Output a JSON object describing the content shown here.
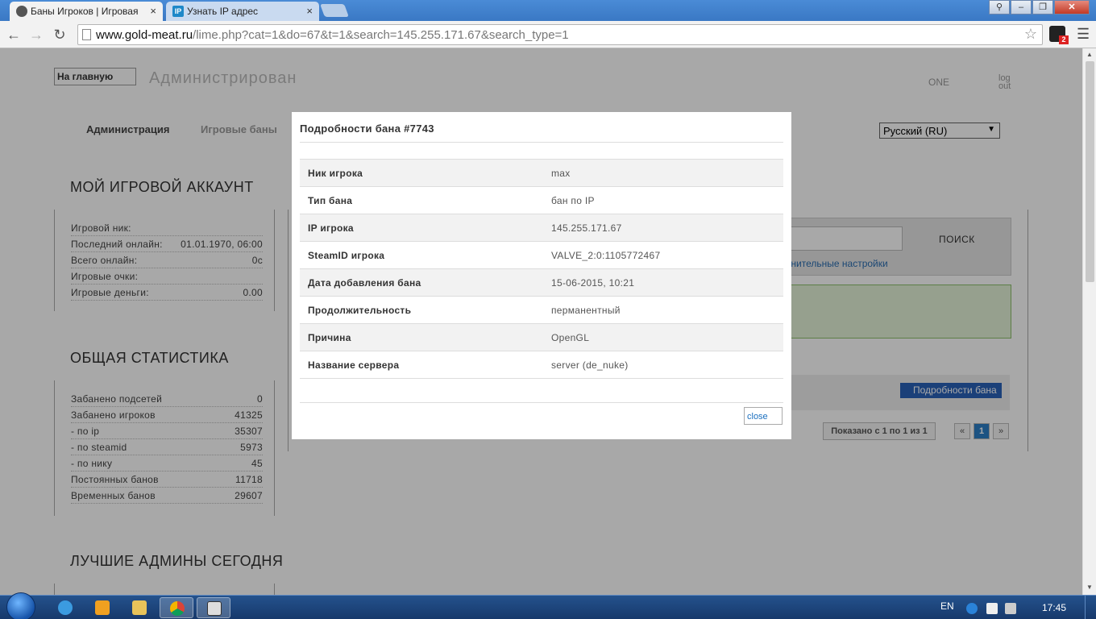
{
  "browser": {
    "tabs": [
      {
        "title": "Баны Игроков | Игровая"
      },
      {
        "title": "Узнать IP адрес",
        "favicon_text": "IP"
      }
    ],
    "tab_close_glyph": "×",
    "url_host": "www.gold-meat.ru",
    "url_path": "/lime.php?cat=1&do=67&t=1&search=145.255.171.67&search_type=1",
    "extension_badge": "2"
  },
  "page": {
    "logo_alt": "На главную",
    "logo_text": "Администрирован",
    "top_links": {
      "one": "ONE",
      "logout": "log out"
    },
    "menu": [
      "Администрация",
      "Игровые баны"
    ],
    "language": "Русский (RU)",
    "account": {
      "heading": "МОЙ ИГРОВОЙ АККАУНТ",
      "rows": [
        {
          "label": "Игровой ник:",
          "value": ""
        },
        {
          "label": "Последний онлайн:",
          "value": "01.01.1970, 06:00"
        },
        {
          "label": "Всего онлайн:",
          "value": "0с"
        },
        {
          "label": "Игровые очки:",
          "value": ""
        },
        {
          "label": "Игровые деньги:",
          "value": "0.00"
        }
      ]
    },
    "stats": {
      "heading": "ОБЩАЯ СТАТИСТИКА",
      "rows": [
        {
          "label": "Забанено подсетей",
          "value": "0"
        },
        {
          "label": "Забанено игроков",
          "value": "41325"
        },
        {
          "label": "- по ip",
          "value": "35307"
        },
        {
          "label": "- по steamid",
          "value": "5973"
        },
        {
          "label": "- по нику",
          "value": "45"
        },
        {
          "label": "Постоянных банов",
          "value": "11718"
        },
        {
          "label": "Временных банов",
          "value": "29607"
        }
      ]
    },
    "best_admins_heading": "ЛУЧШИЕ АДМИНЫ СЕГОДНЯ",
    "search_button": "ПОИСК",
    "advanced_link": "олнительные настройки",
    "details_button": "Подробности бана",
    "shown_info": "Показано с 1 по 1 из 1",
    "pager": {
      "prev": "«",
      "current": "1",
      "next": "»"
    }
  },
  "modal": {
    "title": "Подробности бана #7743",
    "rows": [
      {
        "label": "Ник игрока",
        "value": "max"
      },
      {
        "label": "Тип бана",
        "value": "бан по IP"
      },
      {
        "label": "IP игрока",
        "value": "145.255.171.67"
      },
      {
        "label": "SteamID игрока",
        "value": "VALVE_2:0:1105772467"
      },
      {
        "label": "Дата добавления бана",
        "value": "15-06-2015, 10:21"
      },
      {
        "label": "Продолжительность",
        "value": "перманентный"
      },
      {
        "label": "Причина",
        "value": "OpenGL"
      },
      {
        "label": "Название сервера",
        "value": "server (de_nuke)"
      }
    ],
    "close_label": "close"
  },
  "taskbar": {
    "lang": "EN",
    "time": "17:45"
  }
}
